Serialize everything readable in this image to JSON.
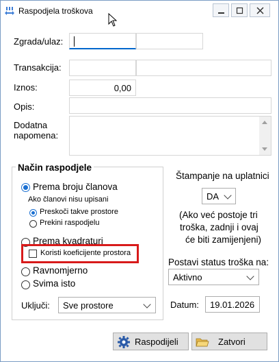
{
  "window": {
    "title": "Raspodjela troškova"
  },
  "form": {
    "zgrada_label": "Zgrada/ulaz:",
    "zgrada_value": "",
    "transakcija_label": "Transakcija:",
    "iznos_label": "Iznos:",
    "iznos_value": "0,00",
    "opis_label": "Opis:",
    "napomena_label_1": "Dodatna",
    "napomena_label_2": "napomena:"
  },
  "raspodjela": {
    "title": "Način raspodjele",
    "option_clanova": "Prema broju članova",
    "sub_note_1": "Ako članovi nisu upisani",
    "sub_preskoci": "Preskoči takve prostore",
    "sub_prekini": "Prekini raspodjelu",
    "option_kvadratura": "Prema kvadraturi",
    "koeficijente_label": "Koristi koeficijente prostora",
    "option_ravnomjerno": "Ravnomjerno",
    "option_svima": "Svima isto",
    "ukljuci_label": "Uključi:",
    "ukljuci_value": "Sve prostore"
  },
  "stampanje": {
    "label": "Štampanje na uplatnici",
    "value": "DA",
    "note_1": "(Ako već postoje tri",
    "note_2": "troška, zadnji i ovaj",
    "note_3": "će biti zamijenjeni)"
  },
  "status": {
    "label": "Postavi status troška na:",
    "value": "Aktivno"
  },
  "datum": {
    "label": "Datum:",
    "value": "19.01.2026"
  },
  "buttons": {
    "raspodijeli": "Raspodijeli",
    "zatvori": "Zatvori"
  },
  "colors": {
    "accent": "#1a6fd1",
    "highlight_box": "#d81a1a"
  }
}
